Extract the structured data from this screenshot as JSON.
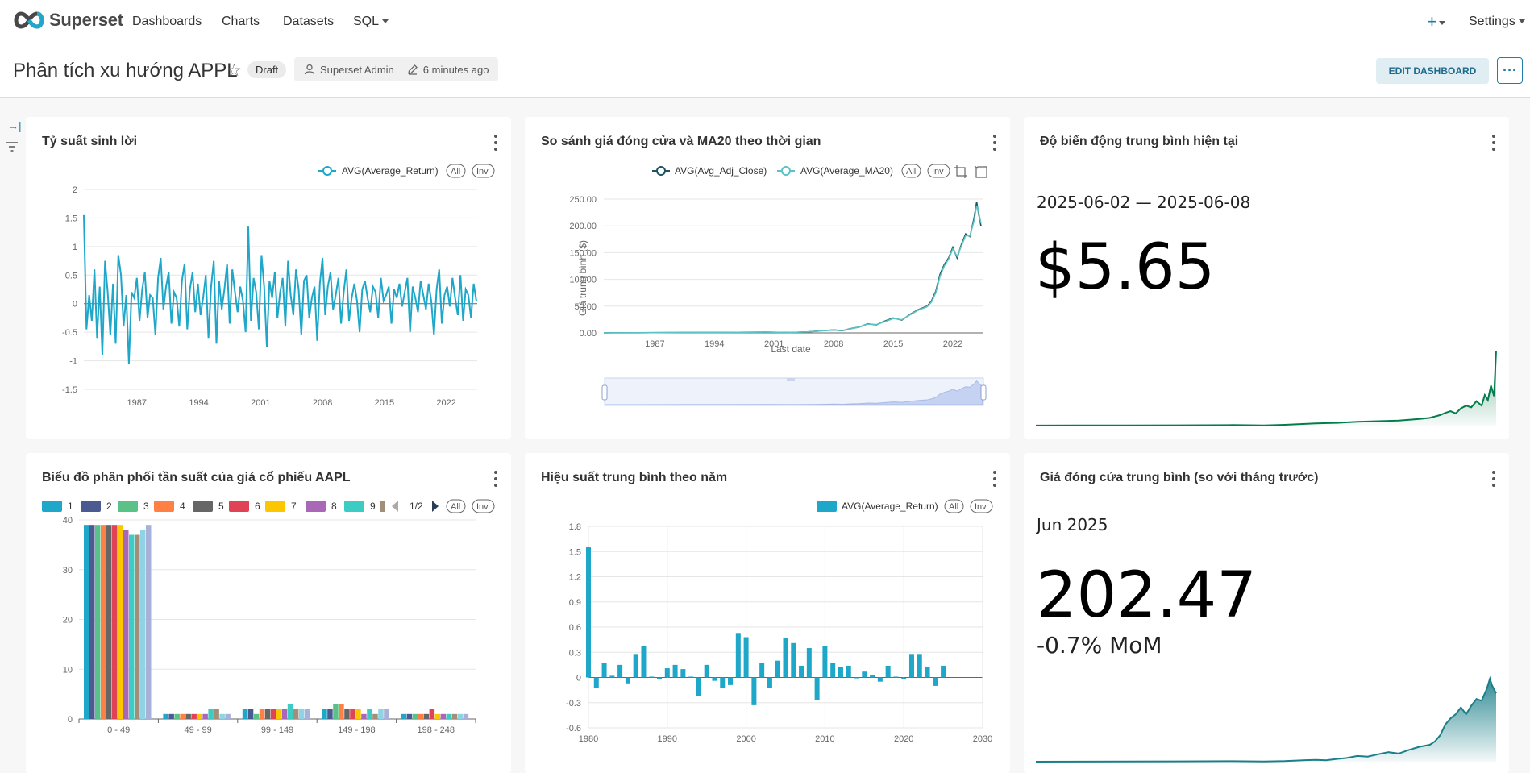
{
  "app": {
    "brand": "Superset",
    "nav": [
      "Dashboards",
      "Charts",
      "Datasets",
      "SQL"
    ],
    "settings_label": "Settings",
    "plus_label": "+"
  },
  "dashboard": {
    "title": "Phân tích xu hướng APPL",
    "status_badge": "Draft",
    "owner": "Superset Admin",
    "modified": "6 minutes ago",
    "edit_label": "EDIT DASHBOARD",
    "more_label": "···"
  },
  "colors": {
    "primary": "#1f7da8",
    "series_blue": "#1ea7c9",
    "ma20": "#5ac4c4",
    "adj_close": "#1d5460",
    "big_number_line": "#057c4d",
    "big_number_line2": "#1b7f89"
  },
  "charts": {
    "returns_line": {
      "title": "Tỷ suất sinh lời",
      "legend": "AVG(Average_Return)",
      "legend_all": "All",
      "legend_inv": "Inv",
      "chart_data": {
        "type": "line",
        "x_ticks": [
          "1987",
          "1994",
          "2001",
          "2008",
          "2015",
          "2022"
        ],
        "y_ticks": [
          "2",
          "1.5",
          "1",
          "0.5",
          "0",
          "-0.5",
          "-1",
          "-1.5"
        ],
        "ylim": [
          -1.5,
          2
        ],
        "xlim": [
          1981,
          2025.5
        ],
        "series": [
          {
            "name": "AVG(Average_Return)",
            "x": [
              1981.0,
              1981.3,
              1981.6,
              1981.9,
              1982.2,
              1982.5,
              1982.8,
              1983.1,
              1983.4,
              1983.7,
              1984.0,
              1984.3,
              1984.6,
              1984.9,
              1985.2,
              1985.5,
              1985.8,
              1986.1,
              1986.4,
              1986.7,
              1987.0,
              1987.3,
              1987.6,
              1987.9,
              1988.2,
              1988.5,
              1988.8,
              1989.1,
              1989.4,
              1989.7,
              1990.0,
              1990.3,
              1990.6,
              1990.9,
              1991.2,
              1991.5,
              1991.8,
              1992.1,
              1992.4,
              1992.7,
              1993.0,
              1993.3,
              1993.6,
              1993.9,
              1994.2,
              1994.5,
              1994.8,
              1995.1,
              1995.4,
              1995.7,
              1996.0,
              1996.3,
              1996.6,
              1996.9,
              1997.2,
              1997.5,
              1997.8,
              1998.1,
              1998.4,
              1998.7,
              1999.0,
              1999.3,
              1999.6,
              1999.9,
              2000.2,
              2000.5,
              2000.8,
              2001.1,
              2001.4,
              2001.7,
              2002.0,
              2002.3,
              2002.6,
              2002.9,
              2003.2,
              2003.5,
              2003.8,
              2004.1,
              2004.4,
              2004.7,
              2005.0,
              2005.3,
              2005.6,
              2005.9,
              2006.2,
              2006.5,
              2006.8,
              2007.1,
              2007.4,
              2007.7,
              2008.0,
              2008.3,
              2008.6,
              2008.9,
              2009.2,
              2009.5,
              2009.8,
              2010.1,
              2010.4,
              2010.7,
              2011.0,
              2011.3,
              2011.6,
              2011.9,
              2012.2,
              2012.5,
              2012.8,
              2013.1,
              2013.4,
              2013.7,
              2014.0,
              2014.3,
              2014.6,
              2014.9,
              2015.2,
              2015.5,
              2015.8,
              2016.1,
              2016.4,
              2016.7,
              2017.0,
              2017.3,
              2017.6,
              2017.9,
              2018.2,
              2018.5,
              2018.8,
              2019.1,
              2019.4,
              2019.7,
              2020.0,
              2020.3,
              2020.6,
              2020.9,
              2021.2,
              2021.5,
              2021.8,
              2022.1,
              2022.4,
              2022.7,
              2023.0,
              2023.3,
              2023.6,
              2023.9,
              2024.2,
              2024.5,
              2024.8,
              2025.1,
              2025.4
            ],
            "values": [
              1.55,
              -0.45,
              0.15,
              -0.3,
              0.6,
              -0.6,
              0.3,
              -0.9,
              0.75,
              0.2,
              -0.55,
              0.35,
              -0.7,
              0.85,
              0.5,
              -0.4,
              0.15,
              -1.05,
              0.2,
              0.1,
              0.45,
              -0.3,
              0.25,
              0.55,
              -0.25,
              0.15,
              0.1,
              -0.55,
              0.45,
              0.8,
              -0.1,
              0.3,
              0.55,
              -0.35,
              0.2,
              0.1,
              -0.4,
              0.4,
              0.7,
              -0.45,
              0.25,
              0.55,
              -0.15,
              0.35,
              -0.2,
              0.1,
              0.5,
              -0.6,
              0.3,
              0.75,
              -0.7,
              0.4,
              -0.1,
              0.25,
              0.7,
              -0.35,
              0.6,
              0.2,
              -0.15,
              0.3,
              0.05,
              -0.5,
              1.35,
              -0.3,
              0.45,
              0.2,
              -0.45,
              0.85,
              0.3,
              -0.75,
              0.4,
              0.1,
              0.55,
              -0.25,
              0.2,
              0.45,
              -0.4,
              0.75,
              0.15,
              -0.2,
              0.6,
              0.25,
              -0.55,
              0.4,
              0.5,
              -0.25,
              0.1,
              0.3,
              -0.65,
              0.35,
              0.8,
              -0.2,
              0.3,
              0.55,
              -0.1,
              0.15,
              0.45,
              -0.35,
              0.2,
              0.6,
              -0.3,
              0.1,
              0.35,
              0.05,
              -0.5,
              0.25,
              0.4,
              0.1,
              -0.15,
              0.3,
              0.2,
              -0.25,
              0.45,
              0.05,
              0.15,
              0.3,
              -0.35,
              0.25,
              0.1,
              0.35,
              -0.05,
              0.2,
              0.45,
              -0.5,
              0.3,
              0.1,
              -0.15,
              0.4,
              0.15,
              -0.1,
              0.35,
              0.05,
              -0.55,
              0.25,
              0.6,
              -0.35,
              0.15,
              0.3,
              -0.05,
              0.45,
              0.1,
              -0.2,
              0.5,
              -0.3,
              0.25,
              0.15,
              -0.25,
              0.35,
              0.05,
              0.2,
              -0.2,
              0.1
            ]
          }
        ]
      }
    },
    "close_ma20": {
      "title": "So sánh giá đóng cửa và MA20 theo thời gian",
      "legend": [
        "AVG(Avg_Adj_Close)",
        "AVG(Average_MA20)"
      ],
      "legend_all": "All",
      "legend_inv": "Inv",
      "chart_data": {
        "type": "line",
        "x_ticks": [
          "1987",
          "1994",
          "2001",
          "2008",
          "2015",
          "2022"
        ],
        "y_ticks": [
          "250.00",
          "200.00",
          "150.00",
          "100.00",
          "50.00",
          "0.00"
        ],
        "ylim": [
          0,
          250
        ],
        "xlim": [
          1981,
          2025.5
        ],
        "xlabel": "Last date",
        "ylabel": "Giá trung bình ($)",
        "series": [
          {
            "name": "AVG(Avg_Adj_Close)",
            "x": [
              1981,
              1985,
              1990,
              1995,
              2000,
              2003,
              2005,
              2007,
              2008,
              2009,
              2010,
              2011,
              2012,
              2013,
              2014,
              2015,
              2016,
              2017,
              2018,
              2019,
              2019.5,
              2020,
              2020.5,
              2021,
              2021.5,
              2022,
              2022.5,
              2023,
              2023.5,
              2024,
              2024.5,
              2024.8,
              2025,
              2025.3
            ],
            "values": [
              0.1,
              0.3,
              0.8,
              0.9,
              1.5,
              0.6,
              2,
              4.5,
              5.5,
              4,
              8,
              11,
              17,
              15,
              22,
              28,
              24,
              35,
              44,
              50,
              60,
              78,
              110,
              128,
              140,
              160,
              140,
              165,
              185,
              180,
              215,
              245,
              225,
              200
            ]
          },
          {
            "name": "AVG(Average_MA20)",
            "x": [
              1981,
              1985,
              1990,
              1995,
              2000,
              2003,
              2005,
              2007,
              2008,
              2009,
              2010,
              2011,
              2012,
              2013,
              2014,
              2015,
              2016,
              2017,
              2018,
              2019,
              2019.5,
              2020,
              2020.5,
              2021,
              2021.5,
              2022,
              2022.5,
              2023,
              2023.5,
              2024,
              2024.5,
              2024.8,
              2025,
              2025.3
            ],
            "values": [
              0.1,
              0.3,
              0.8,
              0.9,
              1.4,
              0.7,
              1.9,
              4.2,
              5.4,
              4.3,
              7.6,
              10.8,
              16.5,
              15.5,
              21,
              27,
              24.5,
              34,
              43,
              49,
              58,
              75,
              106,
              125,
              138,
              157,
              143,
              162,
              182,
              181,
              210,
              238,
              228,
              205
            ]
          }
        ]
      }
    },
    "volatility": {
      "title": "Độ biến động trung bình hiện tại",
      "date_range": "2025-06-02 — 2025-06-08",
      "big_number": "$5.65",
      "chart_data": {
        "type": "area",
        "x": [
          1981,
          1985,
          1990,
          1995,
          2000,
          2003,
          2005,
          2008,
          2010,
          2012,
          2014,
          2016,
          2018,
          2019,
          2020,
          2020.5,
          2021,
          2021.5,
          2022,
          2022.5,
          2023,
          2023.5,
          2024,
          2024.3,
          2024.6,
          2024.9,
          2025.2,
          2025.4
        ],
        "values": [
          0.02,
          0.03,
          0.05,
          0.06,
          0.1,
          0.05,
          0.15,
          0.4,
          0.5,
          0.7,
          0.8,
          0.9,
          1.2,
          1.4,
          1.9,
          2.3,
          2.6,
          2.2,
          3.1,
          3.6,
          3.3,
          4.4,
          3.6,
          5.5,
          4.6,
          7.2,
          5.3,
          13.5
        ]
      }
    },
    "histogram": {
      "title": "Biểu đồ phân phối tần suất của giá cổ phiếu AAPL",
      "legend_items": [
        "1",
        "2",
        "3",
        "4",
        "5",
        "6",
        "7",
        "8",
        "9"
      ],
      "legend_colors": [
        "#1ea7c9",
        "#4b5a91",
        "#5ac189",
        "#ff7f44",
        "#666666",
        "#e04355",
        "#fcc700",
        "#a868b7",
        "#3cccc4"
      ],
      "legend_page": "1/2",
      "legend_all": "All",
      "legend_inv": "Inv",
      "chart_data": {
        "type": "bar",
        "categories": [
          "0 - 49",
          "49 - 99",
          "99 - 149",
          "149 - 198",
          "198 - 248"
        ],
        "y_ticks": [
          "40",
          "30",
          "20",
          "10",
          "0"
        ],
        "ylim": [
          0,
          40
        ],
        "bar_colors": [
          "#1ea7c9",
          "#4b5a91",
          "#5ac189",
          "#ff7f44",
          "#666666",
          "#e04355",
          "#fcc700",
          "#a868b7",
          "#3cccc4",
          "#a38f79",
          "#8fd3e4",
          "#a7b1d9"
        ],
        "series_values": [
          [
            39,
            39,
            39,
            39,
            39,
            39,
            39,
            38,
            37,
            37,
            38,
            39
          ],
          [
            1,
            1,
            1,
            1,
            1,
            1,
            1,
            1,
            2,
            2,
            1,
            1
          ],
          [
            2,
            2,
            1,
            2,
            2,
            2,
            2,
            2,
            3,
            2,
            2,
            2
          ],
          [
            2,
            2,
            3,
            3,
            2,
            2,
            2,
            1,
            2,
            1,
            2,
            2
          ],
          [
            1,
            1,
            1,
            1,
            1,
            2,
            1,
            1,
            1,
            1,
            1,
            1
          ]
        ]
      }
    },
    "yearly_perf": {
      "title": "Hiệu suất trung bình theo năm",
      "legend": "AVG(Average_Return)",
      "legend_all": "All",
      "legend_inv": "Inv",
      "chart_data": {
        "type": "bar",
        "x_ticks": [
          "1980",
          "1990",
          "2000",
          "2010",
          "2020",
          "2030"
        ],
        "y_ticks": [
          "1.8",
          "1.5",
          "1.2",
          "0.9",
          "0.6",
          "0.3",
          "0",
          "-0.3",
          "-0.6"
        ],
        "ylim": [
          -0.6,
          1.8
        ],
        "xlim": [
          1980,
          2030
        ],
        "x": [
          1980,
          1981,
          1982,
          1983,
          1984,
          1985,
          1986,
          1987,
          1988,
          1989,
          1990,
          1991,
          1992,
          1993,
          1994,
          1995,
          1996,
          1997,
          1998,
          1999,
          2000,
          2001,
          2002,
          2003,
          2004,
          2005,
          2006,
          2007,
          2008,
          2009,
          2010,
          2011,
          2012,
          2013,
          2014,
          2015,
          2016,
          2017,
          2018,
          2019,
          2020,
          2021,
          2022,
          2023,
          2024,
          2025
        ],
        "values": [
          1.55,
          -0.12,
          0.17,
          0.02,
          0.15,
          -0.07,
          0.28,
          0.37,
          0.01,
          -0.02,
          0.11,
          0.15,
          0.1,
          0.01,
          -0.22,
          0.15,
          -0.04,
          -0.13,
          -0.09,
          0.53,
          0.48,
          -0.33,
          0.17,
          -0.12,
          0.2,
          0.47,
          0.41,
          0.14,
          0.35,
          -0.27,
          0.37,
          0.17,
          0.12,
          0.14,
          -0.01,
          0.07,
          0.03,
          -0.05,
          0.14,
          0.01,
          -0.02,
          0.28,
          0.28,
          0.13,
          -0.1,
          0.14,
          0.1,
          -0.08
        ]
      }
    },
    "avg_close": {
      "title": "Giá đóng cửa trung bình (so với tháng trước)",
      "period": "Jun 2025",
      "big_number": "202.47",
      "change": "-0.7% MoM",
      "chart_data": {
        "type": "area",
        "x": [
          1981,
          1985,
          1990,
          1995,
          2000,
          2003,
          2005,
          2007,
          2008,
          2009,
          2010,
          2011,
          2012,
          2013,
          2014,
          2015,
          2016,
          2017,
          2018,
          2019,
          2019.5,
          2020,
          2020.5,
          2021,
          2021.5,
          2022,
          2022.5,
          2023,
          2023.5,
          2024,
          2024.5,
          2024.8,
          2025,
          2025.4
        ],
        "values": [
          0.1,
          0.3,
          0.8,
          0.9,
          1.5,
          0.6,
          2,
          4.5,
          5.5,
          4,
          8,
          11,
          17,
          15,
          22,
          28,
          24,
          35,
          44,
          50,
          60,
          78,
          110,
          128,
          140,
          160,
          140,
          165,
          185,
          180,
          215,
          245,
          225,
          202
        ]
      }
    }
  }
}
